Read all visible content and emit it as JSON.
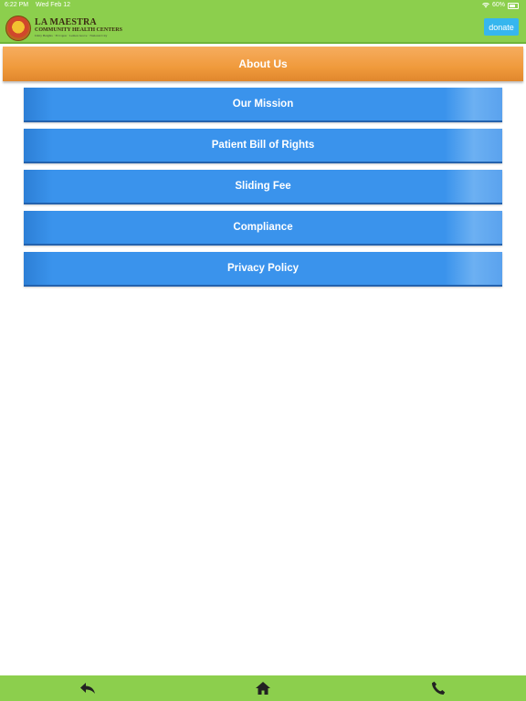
{
  "status_bar": {
    "time": "6:22 PM",
    "date": "Wed Feb 12",
    "battery": "60%"
  },
  "header": {
    "logo": {
      "title": "LA MAESTRA",
      "subtitle": "COMMUNITY HEALTH CENTERS",
      "tagline": "Unity Heights · El Cajon · Lemon Grove · National City"
    },
    "donate_label": "donate"
  },
  "section": {
    "title": "About Us"
  },
  "menu": {
    "items": [
      {
        "label": "Our Mission"
      },
      {
        "label": "Patient Bill of Rights"
      },
      {
        "label": "Sliding Fee"
      },
      {
        "label": "Compliance"
      },
      {
        "label": "Privacy Policy"
      }
    ]
  },
  "bottom_bar": {
    "icons": [
      "back-icon",
      "home-icon",
      "phone-icon"
    ]
  },
  "colors": {
    "header_green": "#8ccf4d",
    "section_orange": "#f09a3c",
    "menu_blue": "#3a93ec",
    "donate_blue": "#36b6ee"
  }
}
